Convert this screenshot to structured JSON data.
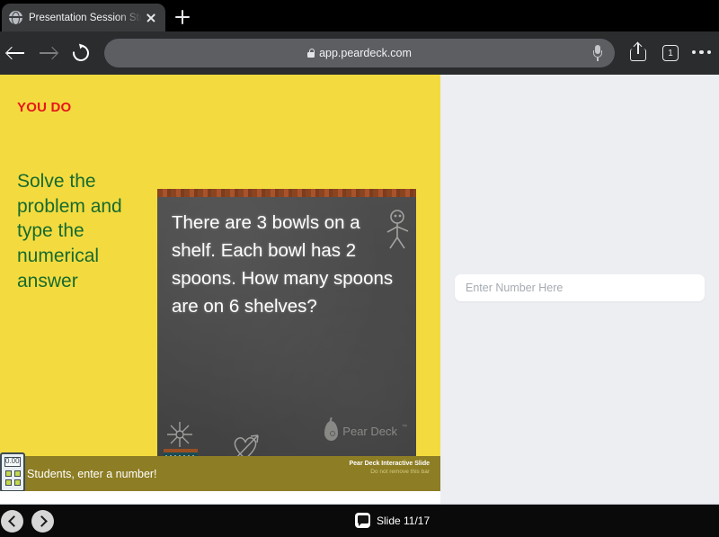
{
  "browser": {
    "tab": {
      "title": "Presentation Session Stu",
      "favicon": "globe-icon",
      "close": "close-icon"
    },
    "new_tab": "+",
    "toolbar": {
      "back": "back-arrow-icon",
      "forward": "forward-arrow-icon",
      "reload": "reload-icon",
      "url": "app.peardeck.com",
      "lock": "lock-icon",
      "microphone": "microphone-icon",
      "share": "share-icon",
      "tab_count": "1",
      "more": "more-options-icon"
    }
  },
  "slide": {
    "heading": "YOU DO",
    "prompt": "Solve the problem and type the numerical answer",
    "board_text": "There are 3 bowls on a shelf. Each bowl has 2 spoons. How many spoons are on 6 shelves?",
    "watermark": "Pear Deck",
    "watermark_tm": "™",
    "background_color": "#f3db3f",
    "heading_color": "#e8161c",
    "prompt_color": "#176a2e"
  },
  "pear_deck_bar": {
    "message": "Students, enter a number!",
    "notice_line1": "Pear Deck Interactive Slide",
    "notice_line2": "Do not remove this bar",
    "calculator_display": "0.00",
    "bar_color": "#8d7d24"
  },
  "response": {
    "input_value": "",
    "input_placeholder": "Enter Number Here",
    "panel_color": "#eceef2"
  },
  "navigation": {
    "previous": "previous-slide-icon",
    "next": "next-slide-icon",
    "slide_counter": "Slide 11/17",
    "counter_icon": "presentation-icon"
  }
}
